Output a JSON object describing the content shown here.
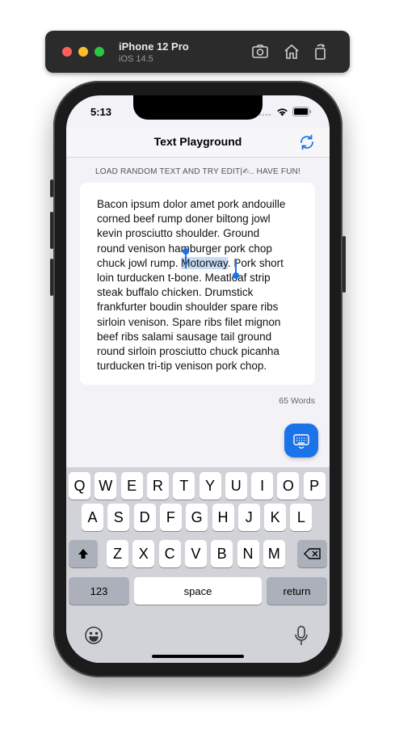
{
  "simulator": {
    "device_name": "iPhone 12 Pro",
    "os_version": "iOS 14.5",
    "buttons": [
      "screenshot-icon",
      "home-icon",
      "rotate-icon"
    ]
  },
  "status_bar": {
    "time": "5:13"
  },
  "nav": {
    "title": "Text Playground",
    "refresh_icon": "refresh-icon"
  },
  "hint": "LOAD RANDOM TEXT AND TRY EDIT|✍.. HAVE FUN!",
  "editor": {
    "before_selection": "Bacon ipsum dolor amet pork andouille\ncorned beef rump doner biltong jowl\nkevin prosciutto shoulder.  Ground\nround venison hamburger pork chop\nchuck jowl rump. ",
    "selection": "Motorway",
    "after_selection": ". Pork short\nloin turducken t-bone.  Meatloaf strip\nsteak buffalo chicken.  Drumstick\nfrankfurter boudin shoulder spare ribs\nsirloin venison.  Spare ribs filet mignon\nbeef ribs salami sausage tail ground\nround sirloin prosciutto chuck picanha\nturducken tri-tip venison pork chop."
  },
  "word_count": "65 Words",
  "keyboard_toggle_icon": "keyboard-icon",
  "keyboard": {
    "row1": [
      "Q",
      "W",
      "E",
      "R",
      "T",
      "Y",
      "U",
      "I",
      "O",
      "P"
    ],
    "row2": [
      "A",
      "S",
      "D",
      "F",
      "G",
      "H",
      "J",
      "K",
      "L"
    ],
    "row3": [
      "Z",
      "X",
      "C",
      "V",
      "B",
      "N",
      "M"
    ],
    "numbers_key": "123",
    "space_key": "space",
    "return_key": "return",
    "shift_icon": "shift-icon",
    "delete_icon": "delete-icon",
    "emoji_icon": "emoji-icon",
    "mic_icon": "microphone-icon"
  },
  "colors": {
    "accent": "#1a73e8",
    "selection": "#c9dcf5",
    "keyboard_bg": "#d1d3d9"
  }
}
